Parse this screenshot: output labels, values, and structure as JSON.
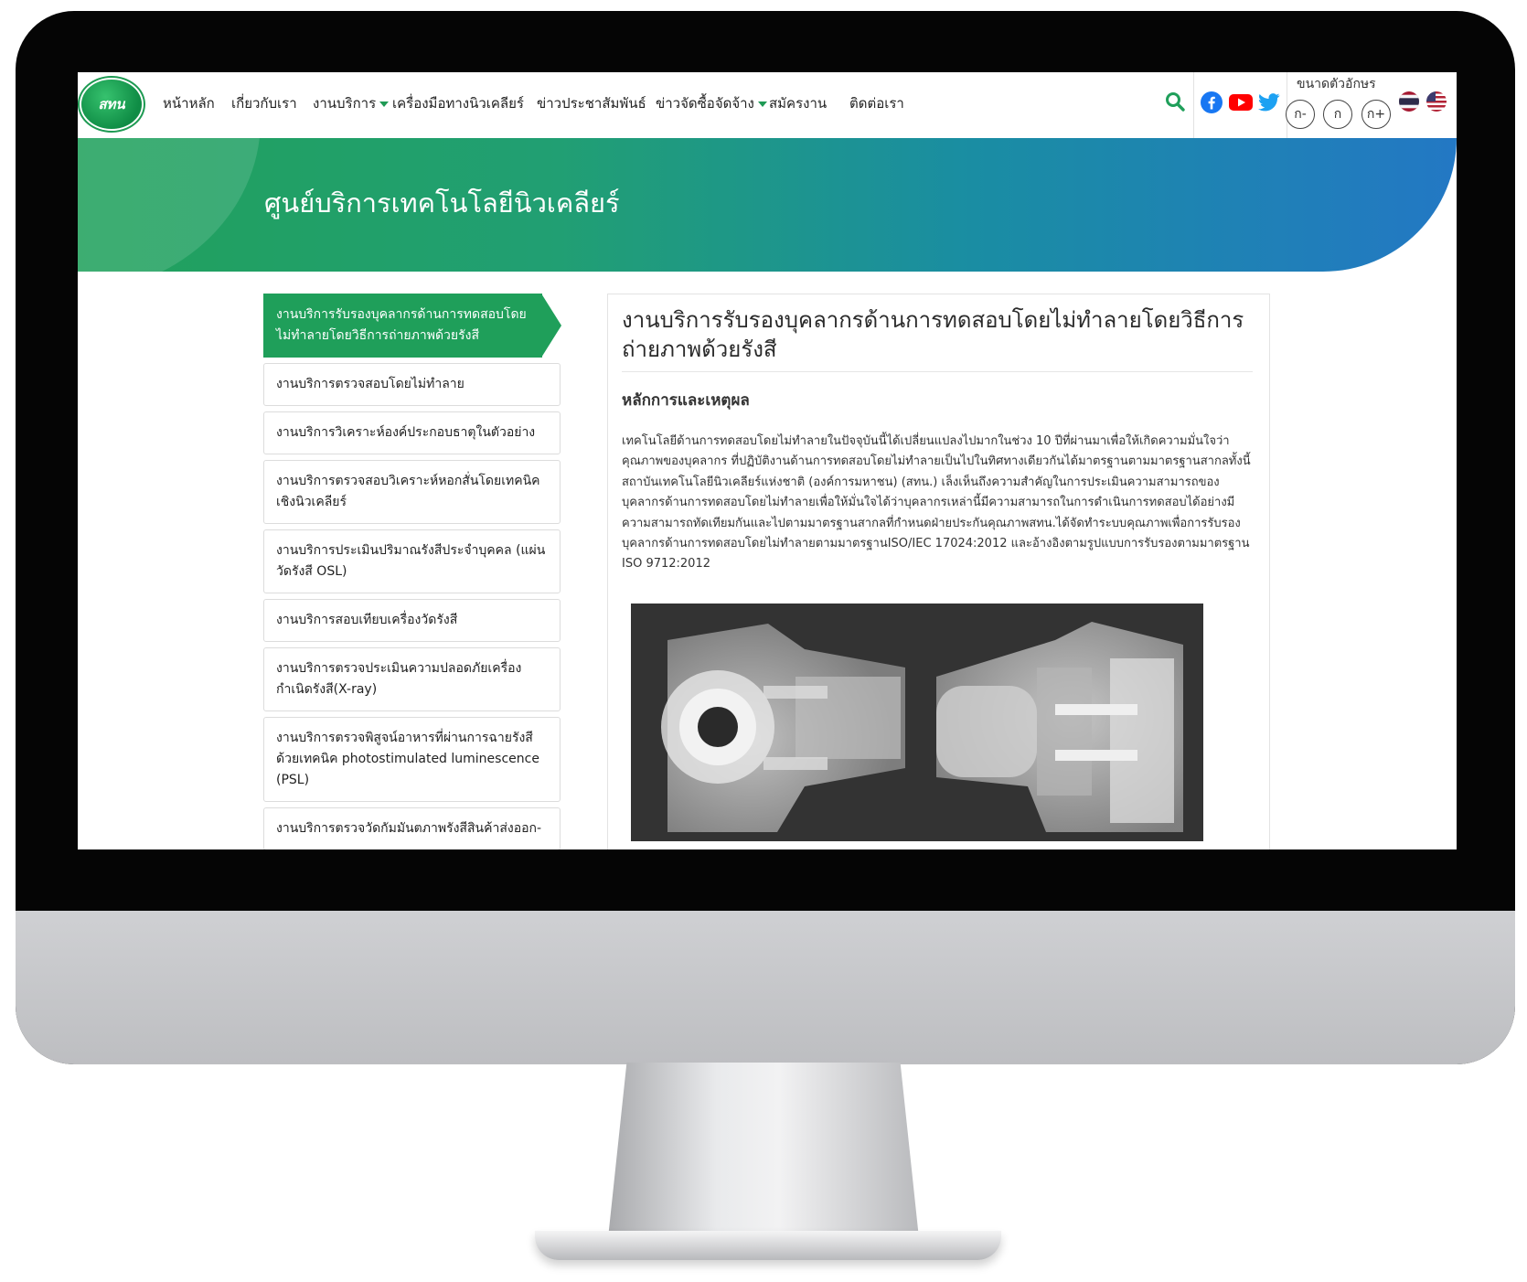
{
  "header": {
    "logo_text": "สทน",
    "nav": [
      {
        "label": "หน้าหลัก",
        "has_dropdown": false
      },
      {
        "label": "เกี่ยวกับเรา",
        "has_dropdown": false
      },
      {
        "label": "งานบริการ",
        "has_dropdown": true
      },
      {
        "label": "เครื่องมือทางนิวเคลียร์",
        "has_dropdown": false
      },
      {
        "label": "ข่าวประชาสัมพันธ์",
        "has_dropdown": false
      },
      {
        "label": "ข่าวจัดซื้อจัดจ้าง",
        "has_dropdown": true
      },
      {
        "label": "สมัครงาน",
        "has_dropdown": false
      },
      {
        "label": "ติดต่อเรา",
        "has_dropdown": false
      }
    ],
    "font_size_label": "ขนาดตัวอักษร",
    "font_buttons": [
      "ก-",
      "ก",
      "ก+"
    ],
    "icons": [
      "search-icon",
      "facebook-icon",
      "youtube-icon",
      "twitter-icon",
      "thai-flag-icon",
      "us-flag-icon"
    ]
  },
  "banner": {
    "title": "ศูนย์บริการเทคโนโลยีนิวเคลียร์"
  },
  "sidebar": {
    "items": [
      "งานบริการรับรองบุคลากรด้านการทดสอบโดยไม่ทำลายโดยวิธีการถ่ายภาพด้วยรังสี",
      "งานบริการตรวจสอบโดยไม่ทำลาย",
      "งานบริการวิเคราะห์องค์ประกอบธาตุในตัวอย่าง",
      "งานบริการตรวจสอบวิเคราะห์หอกสั่นโดยเทคนิคเชิงนิวเคลียร์",
      "งานบริการประเมินปริมาณรังสีประจำบุคคล (แผ่นวัดรังสี OSL)",
      "งานบริการสอบเทียบเครื่องวัดรังสี",
      "งานบริการตรวจประเมินความปลอดภัยเครื่องกำเนิดรังสี(X-ray)",
      "งานบริการตรวจพิสูจน์อาหารที่ผ่านการฉายรังสีด้วยเทคนิค photostimulated luminescence (PSL)",
      "งานบริการตรวจวัดกัมมันตภาพรังสีสินค้าส่งออก-"
    ]
  },
  "content": {
    "title": "งานบริการรับรองบุคลากรด้านการทดสอบโดยไม่ทำลายโดยวิธีการถ่ายภาพด้วยรังสี",
    "section_heading": "หลักการและเหตุผล",
    "body": "เทคโนโลยีด้านการทดสอบโดยไม่ทำลายในปัจจุบันนี้ได้เปลี่ยนแปลงไปมากในช่วง 10 ปีที่ผ่านมาเพื่อให้เกิดความมั่นใจว่าคุณภาพของบุคลากร ที่ปฏิบัติงานด้านการทดสอบโดยไม่ทำลายเป็นไปในทิศทางเดียวกันได้มาตรฐานตามมาตรฐานสากลทั้งนี้สถาบันเทคโนโลยีนิวเคลียร์แห่งชาติ (องค์การมหาชน) (สทน.) เล็งเห็นถึงความสำคัญในการประเมินความสามารถของบุคลากรด้านการทดสอบโดยไม่ทำลายเพื่อให้มั่นใจได้ว่าบุคลากรเหล่านี้มีความสามารถในการดำเนินการทดสอบได้อย่างมีความสามารถทัดเทียมกันและไปตามมาตรฐานสากลที่กำหนดฝ่ายประกันคุณภาพสทน.ได้จัดทำระบบคุณภาพเพื่อการรับรองบุคลากรด้านการทดสอบโดยไม่ทำลายตามมาตรฐานISO/IEC 17024:2012 และอ้างอิงตามรูปแบบการรับรองตามมาตรฐาน ISO 9712:2012"
  },
  "colors": {
    "brand_green": "#1f9f5a",
    "banner_blue": "#2378c4",
    "facebook": "#1877f2",
    "youtube": "#ff0000",
    "twitter": "#1da1f2"
  }
}
